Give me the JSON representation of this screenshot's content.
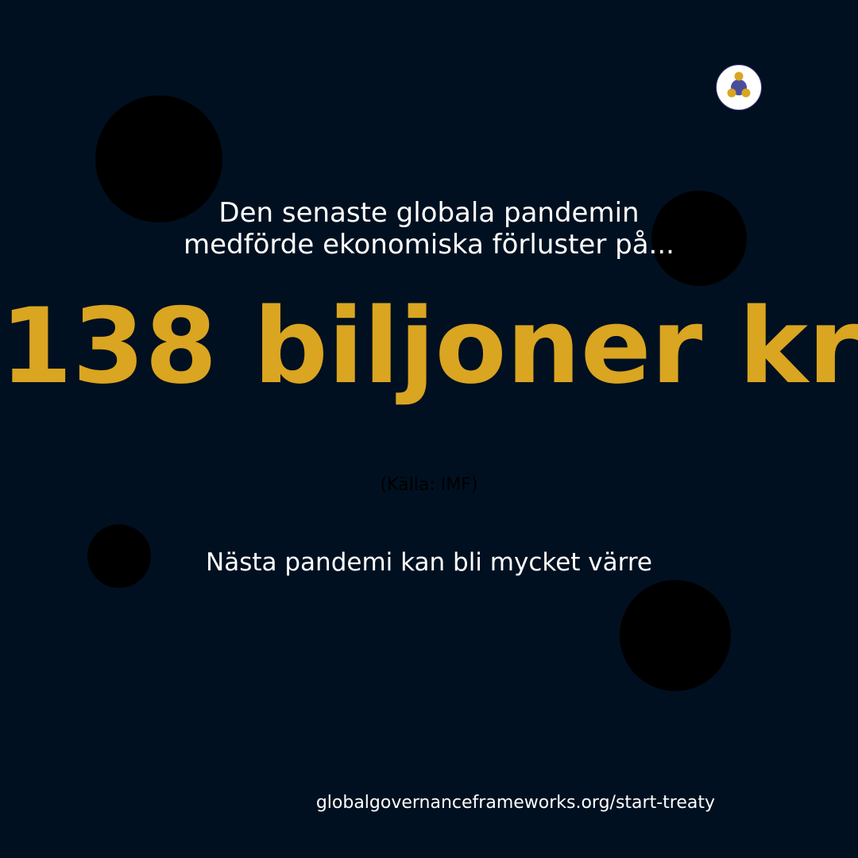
{
  "headline": {
    "line1": "Den senaste globala pandemin",
    "line2": "medförde ekonomiska förluster på..."
  },
  "big_number": "138 biljoner kr",
  "source": "(Källa: IMF)",
  "subheadline": "Nästa pandemi kan bli mycket värre",
  "footer_url": "globalgovernanceframeworks.org/start-treaty",
  "colors": {
    "background": "#001020",
    "accent": "#daa520",
    "logo_center": "#4a4e9a"
  },
  "logo_icon": "three-nodes-network-icon"
}
